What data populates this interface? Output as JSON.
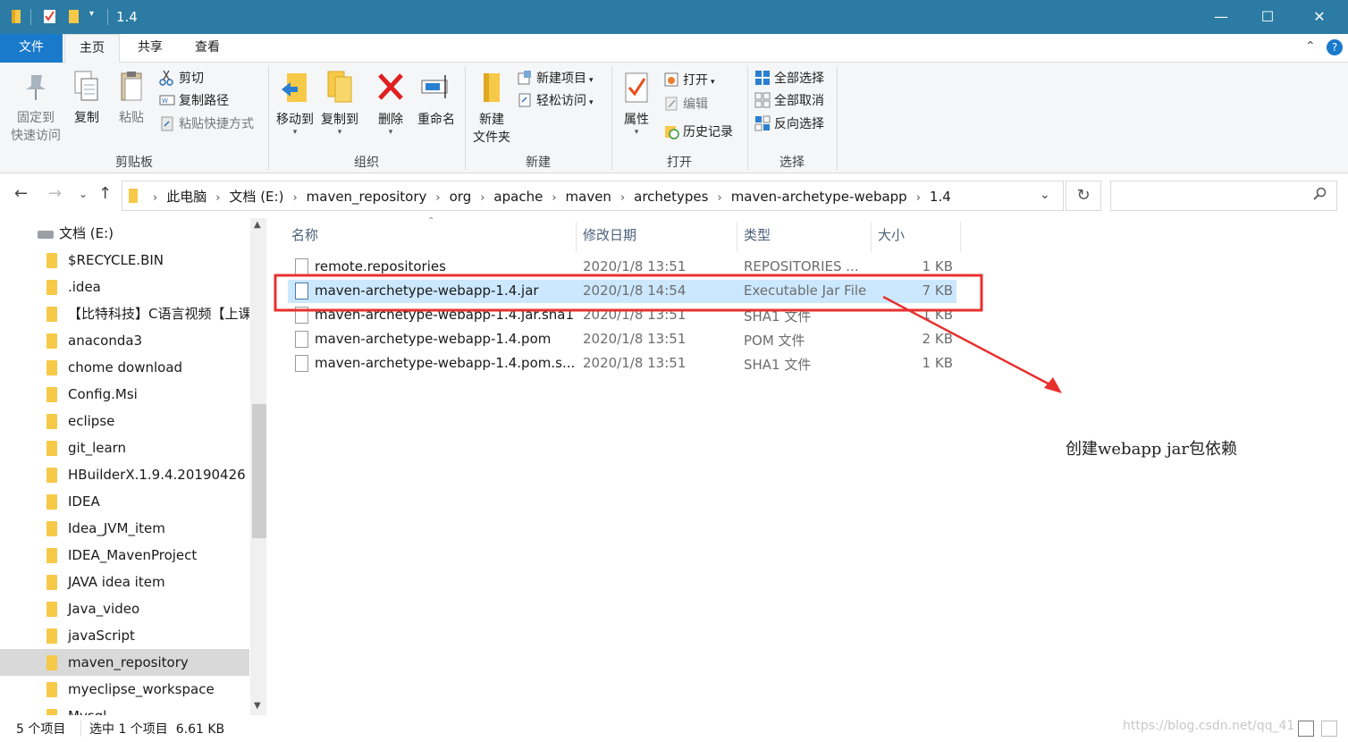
{
  "window": {
    "title": "1.4",
    "min_glyph": "—",
    "max_glyph": "☐",
    "close_glyph": "✕"
  },
  "ribbon_tabs": [
    "文件",
    "主页",
    "共享",
    "查看"
  ],
  "ribbon": {
    "clipboard": {
      "group_label": "剪贴板",
      "pin_line1": "固定到",
      "pin_line2": "快速访问",
      "copy": "复制",
      "paste": "粘贴",
      "cut": "剪切",
      "copy_path": "复制路径",
      "paste_shortcut": "粘贴快捷方式"
    },
    "organize": {
      "group_label": "组织",
      "move_to": "移动到",
      "copy_to": "复制到",
      "delete": "删除",
      "rename": "重命名"
    },
    "new": {
      "group_label": "新建",
      "new_folder_line1": "新建",
      "new_folder_line2": "文件夹",
      "new_item": "新建项目",
      "easy_access": "轻松访问"
    },
    "open": {
      "group_label": "打开",
      "properties": "属性",
      "open": "打开",
      "edit": "编辑",
      "history": "历史记录"
    },
    "select": {
      "group_label": "选择",
      "select_all": "全部选择",
      "select_none": "全部取消",
      "invert": "反向选择"
    }
  },
  "address": {
    "breadcrumbs": [
      "此电脑",
      "文档 (E:)",
      "maven_repository",
      "org",
      "apache",
      "maven",
      "archetypes",
      "maven-archetype-webapp",
      "1.4"
    ]
  },
  "nav_pane": {
    "drive": "文档 (E:)",
    "items": [
      {
        "label": "$RECYCLE.BIN",
        "selected": false
      },
      {
        "label": ".idea",
        "selected": false
      },
      {
        "label": "【比特科技】C语言视频【上课",
        "selected": false
      },
      {
        "label": "anaconda3",
        "selected": false
      },
      {
        "label": "chome download",
        "selected": false
      },
      {
        "label": "Config.Msi",
        "selected": false
      },
      {
        "label": "eclipse",
        "selected": false
      },
      {
        "label": "git_learn",
        "selected": false
      },
      {
        "label": "HBuilderX.1.9.4.20190426",
        "selected": false
      },
      {
        "label": "IDEA",
        "selected": false
      },
      {
        "label": "Idea_JVM_item",
        "selected": false
      },
      {
        "label": "IDEA_MavenProject",
        "selected": false
      },
      {
        "label": "JAVA idea item",
        "selected": false
      },
      {
        "label": "Java_video",
        "selected": false
      },
      {
        "label": "javaScript",
        "selected": false
      },
      {
        "label": "maven_repository",
        "selected": true
      },
      {
        "label": "myeclipse_workspace",
        "selected": false
      },
      {
        "label": "Mysql",
        "selected": false
      }
    ]
  },
  "file_list": {
    "columns": [
      "名称",
      "修改日期",
      "类型",
      "大小"
    ],
    "rows": [
      {
        "name": "remote.repositories",
        "date": "2020/1/8 13:51",
        "type": "REPOSITORIES ...",
        "size": "1 KB",
        "selected": false
      },
      {
        "name": "maven-archetype-webapp-1.4.jar",
        "date": "2020/1/8 14:54",
        "type": "Executable Jar File",
        "size": "7 KB",
        "selected": true
      },
      {
        "name": "maven-archetype-webapp-1.4.jar.sha1",
        "date": "2020/1/8 13:51",
        "type": "SHA1 文件",
        "size": "1 KB",
        "selected": false
      },
      {
        "name": "maven-archetype-webapp-1.4.pom",
        "date": "2020/1/8 13:51",
        "type": "POM 文件",
        "size": "2 KB",
        "selected": false
      },
      {
        "name": "maven-archetype-webapp-1.4.pom.s...",
        "date": "2020/1/8 13:51",
        "type": "SHA1 文件",
        "size": "1 KB",
        "selected": false
      }
    ]
  },
  "annotation": {
    "text": "创建webapp jar包依赖",
    "color": "#e8302d"
  },
  "status_bar": {
    "item_count": "5 个项目",
    "selection": "选中 1 个项目  6.61 KB",
    "watermark": "https://blog.csdn.net/qq_41"
  },
  "colors": {
    "titlebar": "#2b7ba4",
    "file_tab": "#1979ca",
    "selection": "#cce8ff",
    "annotation_red": "#e8302d"
  }
}
